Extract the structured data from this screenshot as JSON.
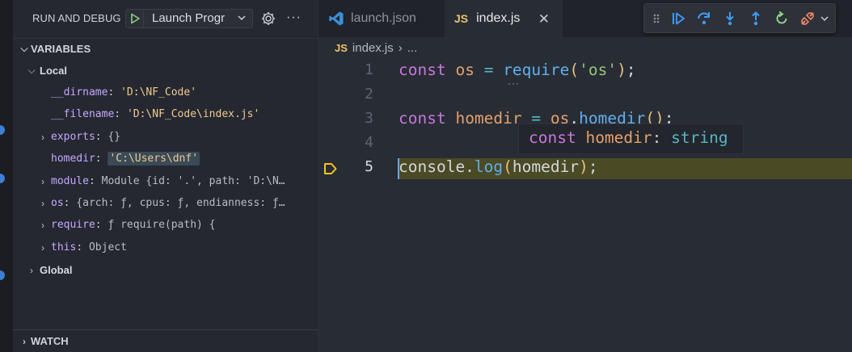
{
  "debug": {
    "title": "RUN AND DEBUG",
    "config": "Launch Progr",
    "play_icon": "play-icon",
    "more": "···"
  },
  "variables": {
    "header": "VARIABLES",
    "local_label": "Local",
    "items": [
      {
        "name": "__dirname",
        "sep": ":",
        "value": "'D:\\NF_Code'",
        "kind": "str"
      },
      {
        "name": "__filename",
        "sep": ":",
        "value": "'D:\\NF_Code\\index.js'",
        "kind": "str"
      },
      {
        "name": "exports",
        "sep": ":",
        "value": "{}",
        "kind": "obj"
      },
      {
        "name": "homedir",
        "sep": ":",
        "value": "'C:\\Users\\dnf'",
        "kind": "str"
      },
      {
        "name": "module",
        "sep": ":",
        "value": "Module {id: '.', path: 'D:\\N…",
        "kind": "obj"
      },
      {
        "name": "os",
        "sep": ":",
        "value": "{arch: ƒ, cpus: ƒ, endianness: ƒ…",
        "kind": "obj"
      },
      {
        "name": "require",
        "sep": ":",
        "value": "ƒ require(path) {",
        "kind": "obj"
      },
      {
        "name": "this",
        "sep": ":",
        "value": "Object",
        "kind": "obj"
      }
    ],
    "global_label": "Global"
  },
  "watch": {
    "header": "WATCH"
  },
  "tabs": [
    {
      "label": "launch.json",
      "icon": "vscode-icon"
    },
    {
      "label": "index.js",
      "icon": "JS",
      "close": "✕"
    }
  ],
  "breadcrumb": {
    "badge": "JS",
    "file": "index.js",
    "chevron": "›",
    "tail": "..."
  },
  "editor": {
    "line_numbers": [
      "1",
      "2",
      "3",
      "4",
      "5"
    ],
    "hover": {
      "kw": "const",
      "name": "homedir",
      "colon": ":",
      "type": "string"
    }
  },
  "colors": {
    "accent": "#3e7fd6",
    "paused_line": "#4a4a25",
    "debug_arrow": "#f5c518",
    "toolbar_icons": "#3c9cff",
    "restart": "#89d185",
    "disconnect": "#f0866b"
  }
}
